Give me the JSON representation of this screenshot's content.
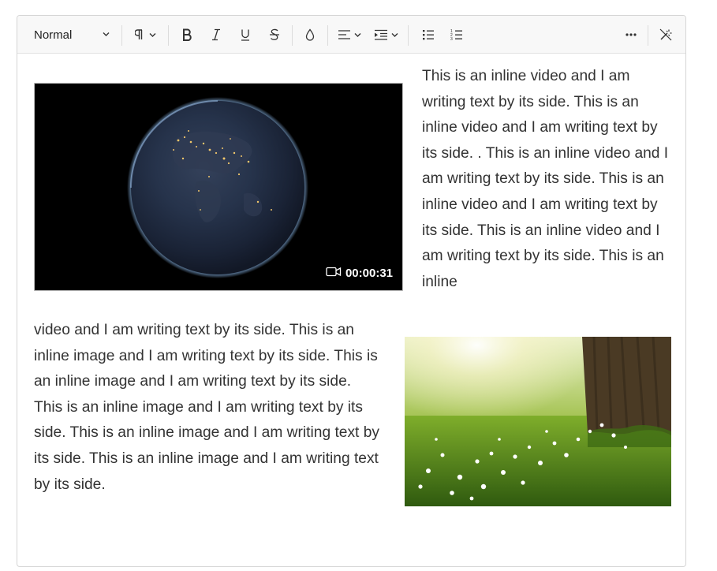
{
  "toolbar": {
    "format_label": "Normal",
    "buttons": [
      {
        "name": "paragraph-format-button",
        "icon": "pilcrow-icon"
      },
      {
        "name": "bold-button",
        "icon": "bold-icon"
      },
      {
        "name": "italic-button",
        "icon": "italic-icon"
      },
      {
        "name": "underline-button",
        "icon": "underline-icon"
      },
      {
        "name": "strikethrough-button",
        "icon": "strikethrough-icon"
      },
      {
        "name": "text-color-button",
        "icon": "droplet-icon"
      },
      {
        "name": "alignment-button",
        "icon": "align-left-icon"
      },
      {
        "name": "indent-button",
        "icon": "indent-icon"
      },
      {
        "name": "bullet-list-button",
        "icon": "bullet-list-icon"
      },
      {
        "name": "numbered-list-button",
        "icon": "numbered-list-icon"
      },
      {
        "name": "more-button",
        "icon": "more-icon"
      },
      {
        "name": "clear-format-button",
        "icon": "magic-wand-icon"
      }
    ]
  },
  "content": {
    "video": {
      "duration": "00:00:31",
      "icon": "video-camera-icon"
    },
    "paragraph_1": "This is an inline video and I am writing text by its side.  This is an inline video and I am writing text by its side.  .  This is an inline video and I am writing text by its side.   This is an inline video and I am writing text by its side.   This is an inline video and I am writing text by its side.   This is an inline",
    "paragraph_2": "video and I am writing text by its side.   This is an inline image and I am writing text by its side.  This is an inline image and I am writing text by its side.  This is an inline image and I am writing text by its side.  This is an inline image and I am writing text by its side.  This is an inline image and I am writing text by its side.",
    "image": {
      "icon": "landscape-photo"
    }
  }
}
